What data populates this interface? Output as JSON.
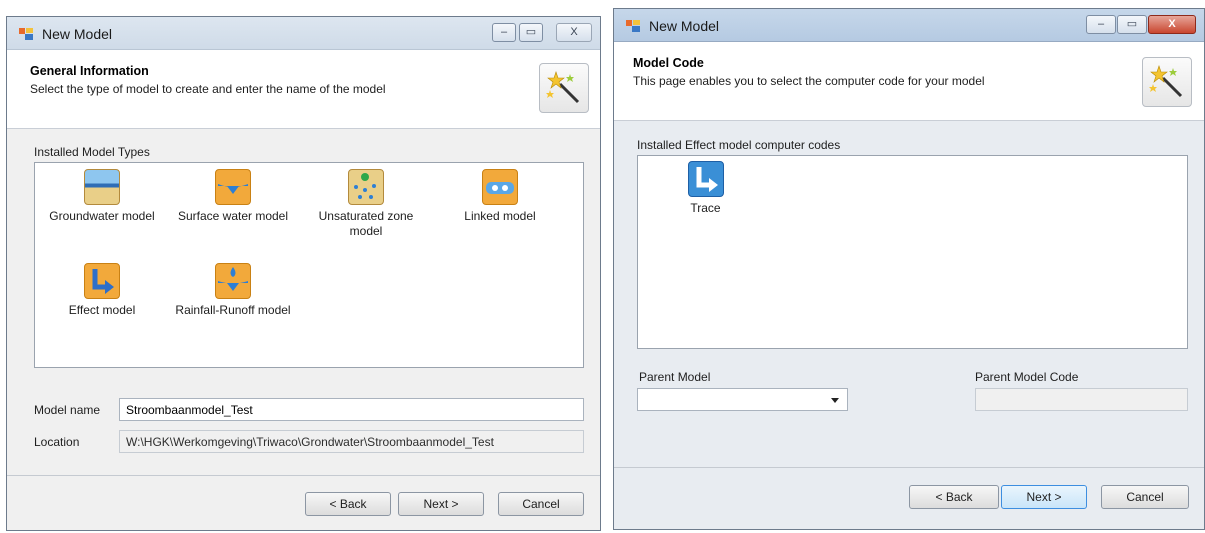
{
  "left_window": {
    "title": "New Model",
    "controls": {
      "minimize": "–",
      "maximize": "▭",
      "close": "X"
    },
    "header": {
      "title": "General Information",
      "subtitle": "Select the type of model to create and enter the name of the model"
    },
    "group_label": "Installed Model Types",
    "model_types": [
      {
        "label": "Groundwater model",
        "icon": "groundwater-icon"
      },
      {
        "label": "Surface water model",
        "icon": "surface-water-icon"
      },
      {
        "label": "Unsaturated zone model",
        "icon": "unsaturated-zone-icon"
      },
      {
        "label": "Linked model",
        "icon": "linked-icon"
      },
      {
        "label": "Effect model",
        "icon": "effect-icon"
      },
      {
        "label": "Rainfall-Runoff model",
        "icon": "rainfall-runoff-icon"
      }
    ],
    "model_name_label": "Model name",
    "model_name_value": "Stroombaanmodel_Test",
    "location_label": "Location",
    "location_value": "W:\\HGK\\Werkomgeving\\Triwaco\\Grondwater\\Stroombaanmodel_Test",
    "buttons": {
      "back": "< Back",
      "next": "Next >",
      "cancel": "Cancel"
    }
  },
  "right_window": {
    "title": "New Model",
    "controls": {
      "minimize": "–",
      "maximize": "▭",
      "close": "X"
    },
    "header": {
      "title": "Model Code",
      "subtitle": "This page enables you to select the computer code for your model"
    },
    "group_label": "Installed Effect model computer codes",
    "codes": [
      {
        "label": "Trace",
        "icon": "trace-icon"
      }
    ],
    "parent_model_label": "Parent Model",
    "parent_model_value": "",
    "parent_model_code_label": "Parent Model Code",
    "parent_model_code_value": "",
    "buttons": {
      "back": "< Back",
      "next": "Next >",
      "cancel": "Cancel"
    }
  },
  "colors": {
    "accent": "#3d8ee0",
    "icon_orange": "#f2a93b",
    "icon_blue": "#3a8fd6"
  }
}
